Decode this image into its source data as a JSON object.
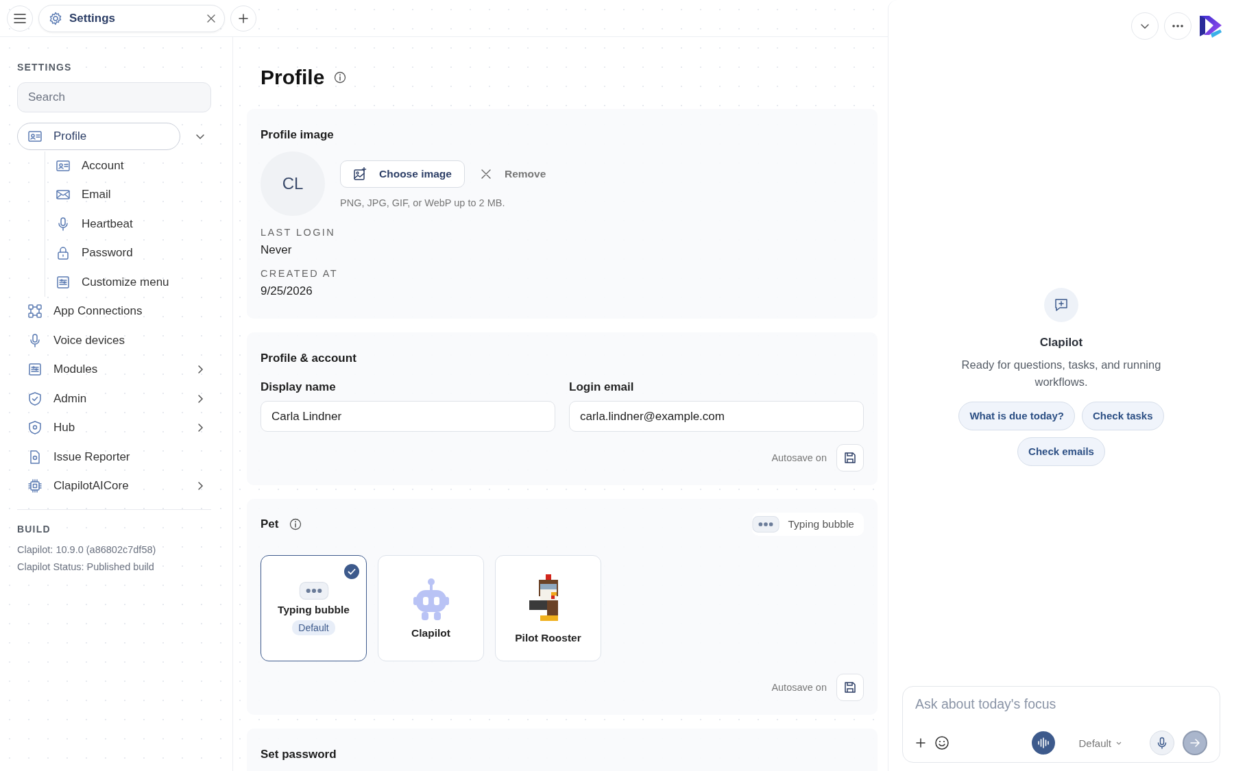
{
  "tab_bar": {
    "tabs": [
      {
        "label": "Settings",
        "selected": true
      }
    ]
  },
  "sidebar": {
    "heading": "SETTINGS",
    "search": {
      "placeholder": "Search"
    },
    "items": [
      {
        "label": "Profile",
        "kind": "group",
        "selected": true,
        "expanded": true,
        "children": [
          {
            "label": "Account",
            "selected": false
          },
          {
            "label": "Email",
            "selected": false
          },
          {
            "label": "Heartbeat",
            "selected": false
          },
          {
            "label": "Password",
            "selected": false
          },
          {
            "label": "Customize menu",
            "selected": false
          }
        ]
      },
      {
        "label": "App Connections",
        "kind": "link",
        "selected": false
      },
      {
        "label": "Voice devices",
        "kind": "link",
        "selected": false
      },
      {
        "label": "Modules",
        "kind": "group",
        "selected": false,
        "expanded": false
      },
      {
        "label": "Admin",
        "kind": "group",
        "selected": false,
        "expanded": false
      },
      {
        "label": "Hub",
        "kind": "group",
        "selected": false,
        "expanded": false
      },
      {
        "label": "Issue Reporter",
        "kind": "link",
        "selected": false
      },
      {
        "label": "ClapilotAICore",
        "kind": "group",
        "selected": false,
        "expanded": false
      }
    ],
    "build": {
      "heading": "BUILD",
      "lines": [
        "Clapilot: 10.9.0 (a86802c7df58)",
        "Clapilot Status: Published build"
      ]
    }
  },
  "page": {
    "title": "Profile"
  },
  "profile_image": {
    "heading": "Profile image",
    "initials": "CL",
    "choose_button": "Choose image",
    "remove_button": "Remove",
    "hint": "PNG, JPG, GIF, or WebP up to 2 MB.",
    "facts": [
      {
        "label": "LAST LOGIN",
        "value": "Never"
      },
      {
        "label": "CREATED AT",
        "value": "9/25/2026"
      }
    ]
  },
  "profile_account": {
    "heading": "Profile & account",
    "fields": [
      {
        "label": "Display name",
        "value": "Carla Lindner"
      },
      {
        "label": "Login email",
        "value": "carla.lindner@example.com"
      }
    ],
    "autosave": "Autosave on"
  },
  "pet": {
    "heading": "Pet",
    "current": "Typing bubble",
    "options": [
      {
        "name": "Typing bubble",
        "badge": "Default",
        "selected": true
      },
      {
        "name": "Clapilot",
        "selected": false
      },
      {
        "name": "Pilot Rooster",
        "selected": false
      }
    ],
    "autosave": "Autosave on"
  },
  "set_password": {
    "heading": "Set password"
  },
  "assistant": {
    "name": "Clapilot",
    "tagline": "Ready for questions, tasks, and running workflows.",
    "suggestions": [
      "What is due today?",
      "Check tasks",
      "Check emails"
    ],
    "composer": {
      "placeholder": "Ask about today's focus",
      "model": "Default"
    }
  }
}
